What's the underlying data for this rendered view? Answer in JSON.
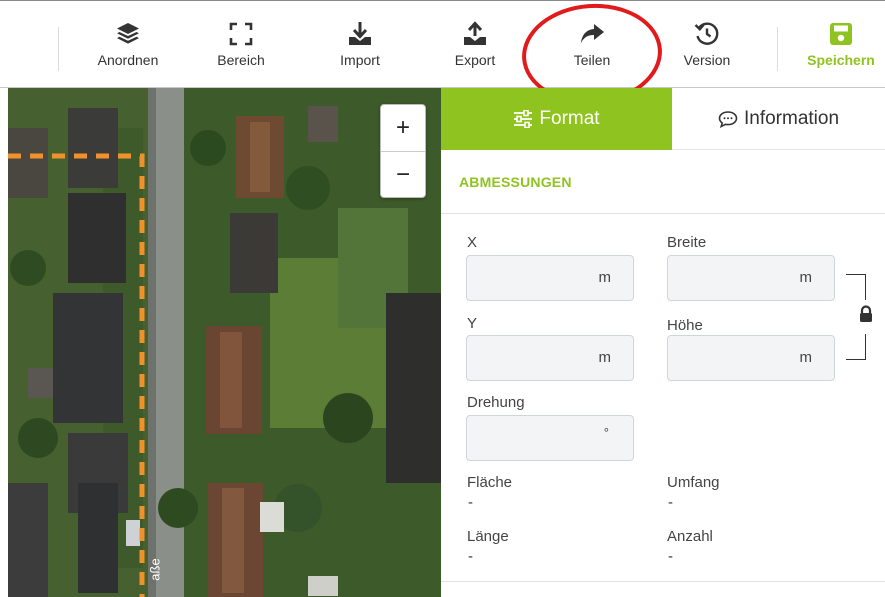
{
  "toolbar": {
    "anordnen": "Anordnen",
    "bereich": "Bereich",
    "import": "Import",
    "export": "Export",
    "teilen": "Teilen",
    "version": "Version",
    "speichern": "Speichern"
  },
  "colors": {
    "accent": "#8fc31f",
    "highlight_circle": "#e11b1b",
    "boundary_dash": "#f0922b"
  },
  "map": {
    "zoom_in": "+",
    "zoom_out": "−",
    "street_label": "aße"
  },
  "panel": {
    "tabs": [
      {
        "label": "Format",
        "icon": "sliders-icon",
        "active": true
      },
      {
        "label": "Information",
        "icon": "speech-bubble-icon",
        "active": false
      }
    ],
    "section_title": "ABMESSUNGEN",
    "fields": {
      "x": {
        "label": "X",
        "value": "",
        "unit": "m"
      },
      "breite": {
        "label": "Breite",
        "value": "",
        "unit": "m"
      },
      "y": {
        "label": "Y",
        "value": "",
        "unit": "m"
      },
      "hoehe": {
        "label": "Höhe",
        "value": "",
        "unit": "m"
      },
      "drehung": {
        "label": "Drehung",
        "value": "",
        "unit": "°"
      }
    },
    "stats": {
      "flaeche": {
        "label": "Fläche",
        "value": "-"
      },
      "umfang": {
        "label": "Umfang",
        "value": "-"
      },
      "laenge": {
        "label": "Länge",
        "value": "-"
      },
      "anzahl": {
        "label": "Anzahl",
        "value": "-"
      }
    }
  }
}
